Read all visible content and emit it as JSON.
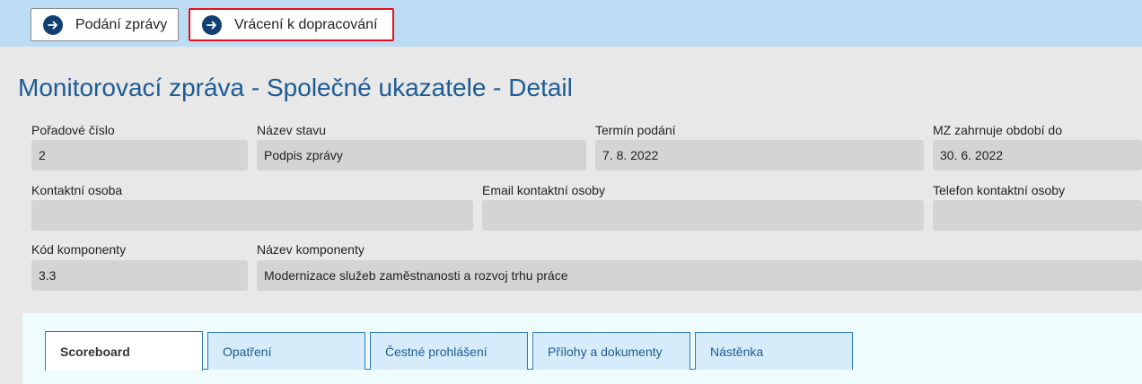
{
  "toolbar": {
    "submit_label": "Podání zprávy",
    "return_label": "Vrácení k dopracování"
  },
  "page": {
    "title": "Monitorovací zpráva - Společné ukazatele - Detail"
  },
  "fields": {
    "order_number": {
      "label": "Pořadové číslo",
      "value": "2"
    },
    "state_name": {
      "label": "Název stavu",
      "value": "Podpis zprávy"
    },
    "submit_deadline": {
      "label": "Termín podání",
      "value": "7. 8. 2022"
    },
    "period_to": {
      "label": "MZ zahrnuje období do",
      "value": "30. 6. 2022"
    },
    "contact_person": {
      "label": "Kontaktní osoba",
      "value": ""
    },
    "contact_email": {
      "label": "Email kontaktní osoby",
      "value": ""
    },
    "contact_phone": {
      "label": "Telefon kontaktní osoby",
      "value": ""
    },
    "component_code": {
      "label": "Kód komponenty",
      "value": "3.3"
    },
    "component_name": {
      "label": "Název komponenty",
      "value": "Modernizace služeb zaměstnanosti a rozvoj trhu práce"
    }
  },
  "tabs": [
    {
      "label": "Scoreboard",
      "active": true
    },
    {
      "label": "Opatření",
      "active": false
    },
    {
      "label": "Čestné prohlášení",
      "active": false
    },
    {
      "label": "Přílohy a dokumenty",
      "active": false
    },
    {
      "label": "Nástěnka",
      "active": false
    }
  ],
  "icons": {
    "toolbar_button_icon": "arrow-right-circle-icon"
  },
  "colors": {
    "toolbar_bg": "#bcdcf3",
    "title": "#1d5b94",
    "icon_bg": "#123f73",
    "highlight_border": "#e0131c",
    "tab_border": "#2f79bd"
  }
}
